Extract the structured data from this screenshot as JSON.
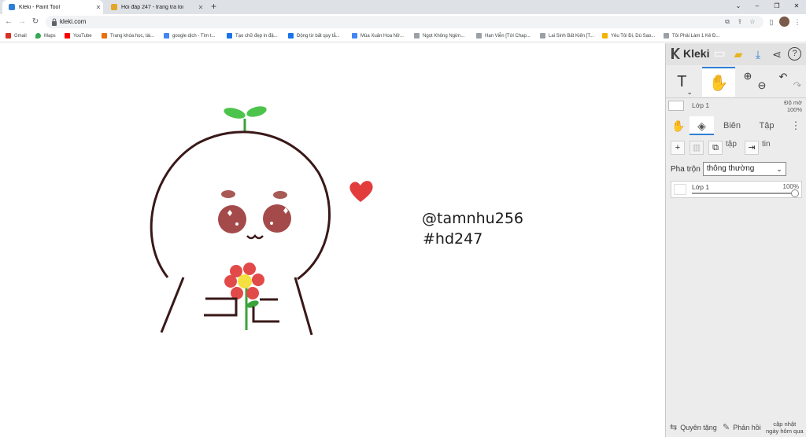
{
  "browser": {
    "tabs": [
      {
        "title": "Kleki - Paint Tool",
        "active": true,
        "favicon_color": "#2f7fd6"
      },
      {
        "title": "Hỏi đáp 247 - trang tra loi",
        "active": false,
        "favicon_color": "#e2a526"
      }
    ],
    "new_tab_icon": "plus-icon",
    "url": "kleki.com",
    "bookmarks": [
      {
        "label": "Gmail",
        "icon_color": "#d93025"
      },
      {
        "label": "Maps",
        "icon_color": "#34a853"
      },
      {
        "label": "YouTube",
        "icon_color": "#ff0000"
      },
      {
        "label": "Trang khóa học, tài...",
        "icon_color": "#e8710a"
      },
      {
        "label": "google dịch - Tìm t...",
        "icon_color": "#4285f4"
      },
      {
        "label": "Tạo chữ đẹp in đậ...",
        "icon_color": "#1a73e8"
      },
      {
        "label": "Động từ bất quy tắ...",
        "icon_color": "#1a73e8"
      },
      {
        "label": "Mùa Xuân Hoa Nở...",
        "icon_color": "#4285f4"
      },
      {
        "label": "Ngọt Không Ngừn...",
        "icon_color": "#9aa0a6"
      },
      {
        "label": "Hạn Viễn [Tới Chap...",
        "icon_color": "#9aa0a6"
      },
      {
        "label": "Lai Sinh Bất Kiến [T...",
        "icon_color": "#9aa0a6"
      },
      {
        "label": "Yêu Tôi Đi, Dù Sao...",
        "icon_color": "#f2b400"
      },
      {
        "label": "Tôi Phải Làm 1 Kẻ Đ...",
        "icon_color": "#9aa0a6"
      }
    ]
  },
  "canvas": {
    "text_line1": "@tamnhu256",
    "text_line2": "#hd247"
  },
  "panel": {
    "app_name": "Kleki",
    "accent_color": "#2f7fd6",
    "tools": {
      "text_tool": "T",
      "hand_tool": "✋"
    },
    "layer_bar": {
      "name": "Lớp 1",
      "opacity_label": "Độ mờ",
      "opacity_value": "100%"
    },
    "tabs": {
      "edit": "Biên",
      "file": "Tập"
    },
    "layer_buttons": {
      "duplicate_label": "tập",
      "merge_label": "tin"
    },
    "blend": {
      "label": "Pha trộn",
      "value": "thông thường"
    },
    "layer_item": {
      "name": "Lớp 1",
      "opacity": "100%",
      "opacity_level": 1.0
    },
    "footer": {
      "donate": "Quyên tặng",
      "feedback": "Phản hồi",
      "changelog_line1": "cập nhật",
      "changelog_line2": "ngày hôm qua"
    }
  }
}
